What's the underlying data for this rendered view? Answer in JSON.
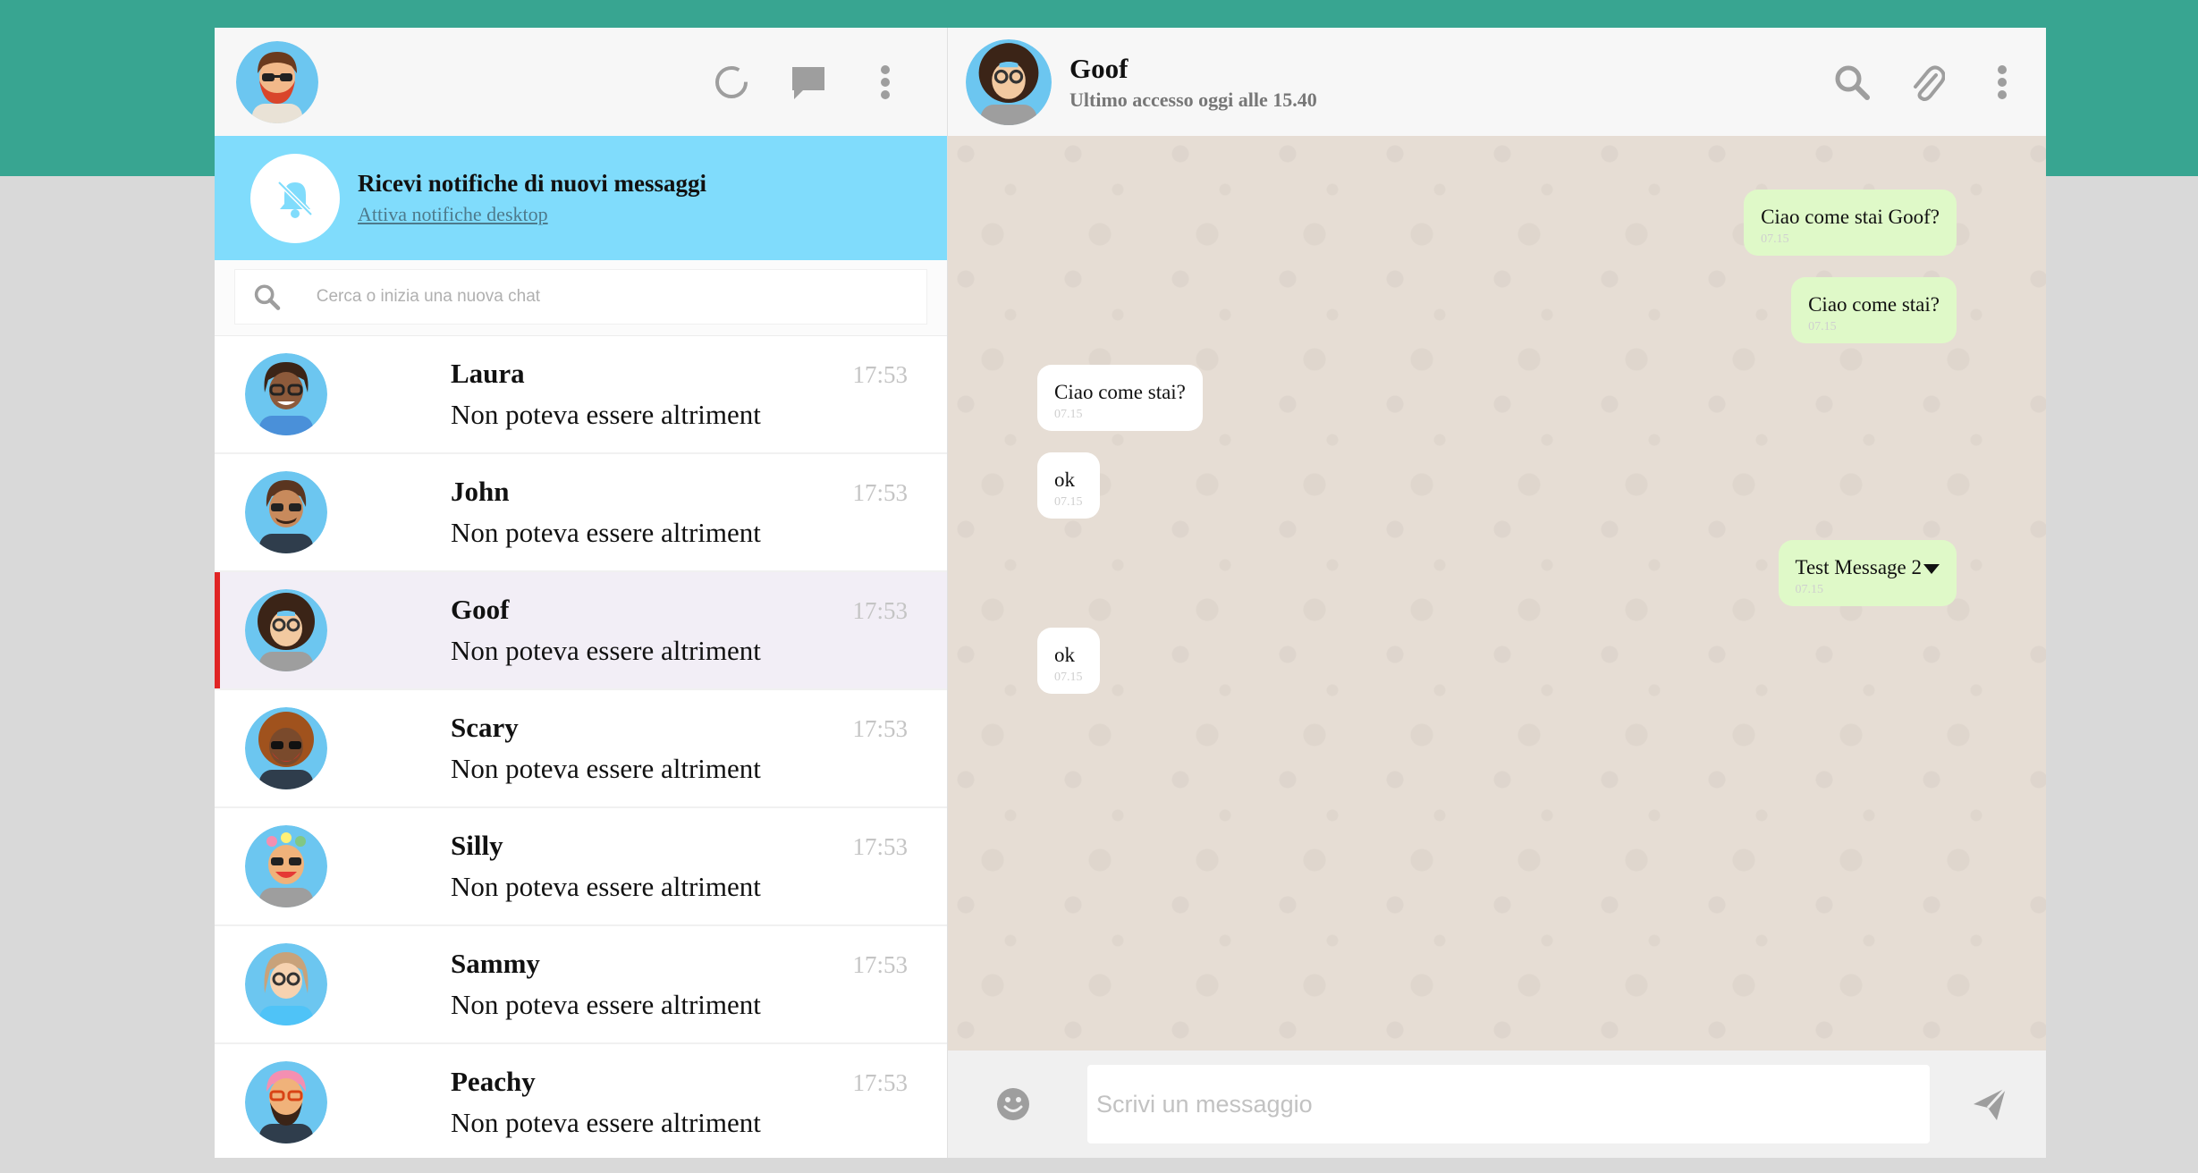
{
  "current_user": {
    "avatar": "bearded-red-avatar"
  },
  "left_header": {
    "icons": [
      "status-icon",
      "new-chat-icon",
      "menu-icon"
    ]
  },
  "notification": {
    "icon": "bell-off-icon",
    "title": "Ricevi notifiche di nuovi messaggi",
    "link": "Attiva notifiche desktop"
  },
  "search": {
    "placeholder": "Cerca o inizia una nuova chat",
    "icon": "search-icon"
  },
  "chats": [
    {
      "name": "Laura",
      "time": "17:53",
      "preview": "Non poteva essere altriment",
      "active": false
    },
    {
      "name": "John",
      "time": "17:53",
      "preview": "Non poteva essere altriment",
      "active": false
    },
    {
      "name": "Goof",
      "time": "17:53",
      "preview": "Non poteva essere altriment",
      "active": true
    },
    {
      "name": "Scary",
      "time": "17:53",
      "preview": "Non poteva essere altriment",
      "active": false
    },
    {
      "name": "Silly",
      "time": "17:53",
      "preview": "Non poteva essere altriment",
      "active": false
    },
    {
      "name": "Sammy",
      "time": "17:53",
      "preview": "Non poteva essere altriment",
      "active": false
    },
    {
      "name": "Peachy",
      "time": "17:53",
      "preview": "Non poteva essere altriment",
      "active": false
    }
  ],
  "conversation_header": {
    "name": "Goof",
    "status": "Ultimo accesso oggi alle 15.40",
    "icons": [
      "search-icon",
      "attach-icon",
      "menu-icon"
    ]
  },
  "messages": [
    {
      "dir": "out",
      "text": "Ciao come stai Goof?",
      "time": "07.15"
    },
    {
      "dir": "out",
      "text": "Ciao come stai?",
      "time": "07.15"
    },
    {
      "dir": "in",
      "text": "Ciao come stai?",
      "time": "07.15"
    },
    {
      "dir": "in",
      "text": "ok",
      "time": "07.15"
    },
    {
      "dir": "out",
      "text": "Test Message 2",
      "time": "07.15",
      "has_dropdown": true
    },
    {
      "dir": "in",
      "text": "ok",
      "time": "07.15"
    }
  ],
  "compose": {
    "placeholder": "Scrivi un messaggio",
    "emoji_icon": "emoji-icon",
    "send_icon": "send-icon"
  },
  "colors": {
    "top_band": "#38a591",
    "notification_bg": "#80dcfc",
    "outgoing_bubble": "#dff9c8",
    "incoming_bubble": "#ffffff",
    "active_indicator": "#e02424",
    "chat_bg": "#e6ddd4"
  }
}
